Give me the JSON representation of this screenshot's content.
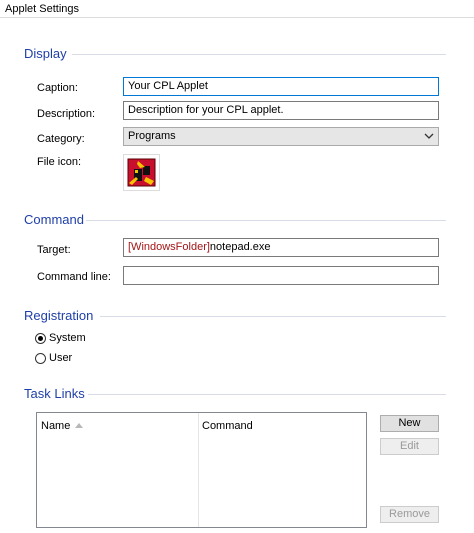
{
  "window": {
    "title": "Applet Settings"
  },
  "display": {
    "heading": "Display",
    "caption_label": "Caption:",
    "caption_value": "Your CPL Applet",
    "description_label": "Description:",
    "description_value": "Description for your CPL applet.",
    "category_label": "Category:",
    "category_value": "Programs",
    "file_icon_label": "File icon:",
    "file_icon": "cpl-applet-icon"
  },
  "command": {
    "heading": "Command",
    "target_label": "Target:",
    "target_token": "[WindowsFolder]",
    "target_rest": "notepad.exe",
    "command_line_label": "Command line:",
    "command_line_value": ""
  },
  "registration": {
    "heading": "Registration",
    "options": [
      {
        "label": "System",
        "selected": true
      },
      {
        "label": "User",
        "selected": false
      }
    ]
  },
  "task_links": {
    "heading": "Task Links",
    "columns": [
      "Name",
      "Command"
    ],
    "rows": [],
    "buttons": {
      "new": "New",
      "edit": "Edit",
      "remove": "Remove"
    }
  },
  "colors": {
    "section_heading": "#1f3fa8",
    "focus_border": "#0078d7",
    "token_text": "#a31515",
    "icon_red": "#c8102e",
    "icon_yellow": "#f5c400"
  }
}
